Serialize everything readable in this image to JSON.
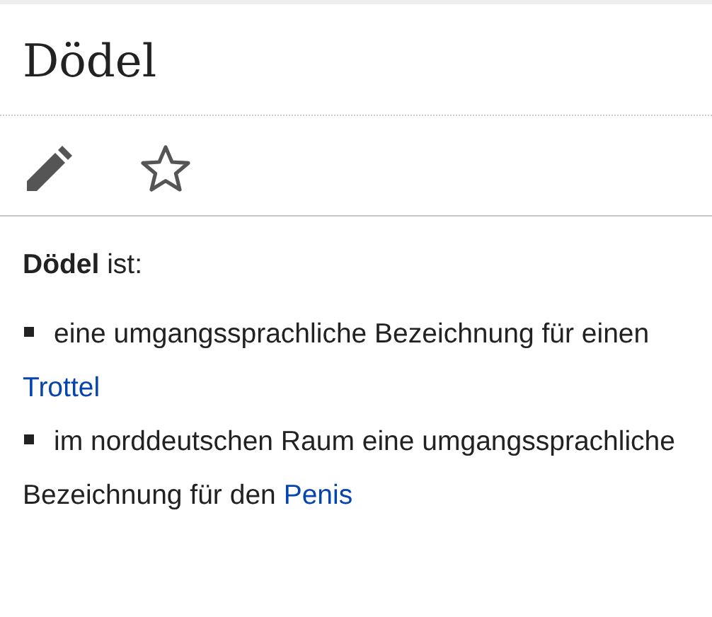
{
  "title": "Dödel",
  "intro": "**Dödel** ist:",
  "items": [
    {
      "text": "eine umgangssprachliche Bezeichnung für einen ",
      "link": "Trottel"
    },
    {
      "text": "im norddeutschen Raum eine umgangssprachliche Bezeichnung für den ",
      "link": "Penis"
    }
  ]
}
